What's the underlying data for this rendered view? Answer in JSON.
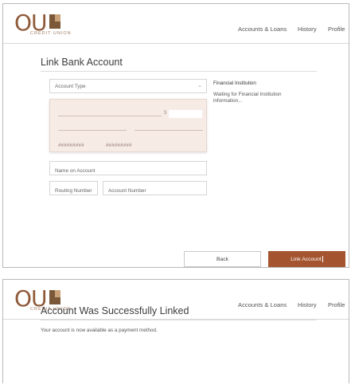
{
  "header": {
    "logo_text": "OU",
    "logo_sub": "CREDIT UNION",
    "nav": [
      "Accounts & Loans",
      "History",
      "Profile"
    ]
  },
  "link_form": {
    "title": "Link Bank Account",
    "account_type": {
      "label": "Account Type"
    },
    "financial_institution": {
      "title": "Financial Institution",
      "status": "Waiting for Financial Institution information..."
    },
    "check": {
      "dollar_sign": "$",
      "micr_routing": "#########",
      "micr_account": "#########"
    },
    "fields": {
      "name_placeholder": "Name on Account",
      "routing_placeholder": "Routing Number",
      "account_placeholder": "Account Number"
    },
    "buttons": {
      "back": "Back",
      "link": "Link Account"
    }
  },
  "success": {
    "title": "Account Was Successfully Linked",
    "message": "Your account is now available as a payment method."
  },
  "colors": {
    "accent": "#a4542e",
    "logo_brown": "#8f5a3a",
    "check_bg": "#f7ebe6"
  },
  "icons": {
    "select_chevron": "chevron-down-icon"
  }
}
